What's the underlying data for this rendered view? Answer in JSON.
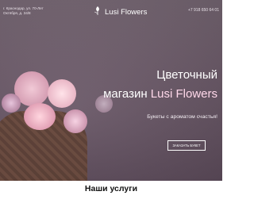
{
  "header": {
    "address": "г. Краснодар, ул. 70-Лет Октября, д. 34/8",
    "logo_text": "Lusi Flowers",
    "phone": "+7 918 650 64 01"
  },
  "hero": {
    "title_line1": "Цветочный",
    "title_line2_prefix": "магазин ",
    "title_line2_brand": "Lusi Flowers",
    "subtitle": "Букеты с ароматом счастья!",
    "cta_label": "ЗАКАЗАТЬ БУКЕТ"
  },
  "sections": {
    "services_title": "Наши услуги"
  },
  "colors": {
    "brand_accent": "#ffd8ea",
    "hero_overlay": "#6e5c6b"
  },
  "icons": {
    "logo": "flower-icon"
  }
}
